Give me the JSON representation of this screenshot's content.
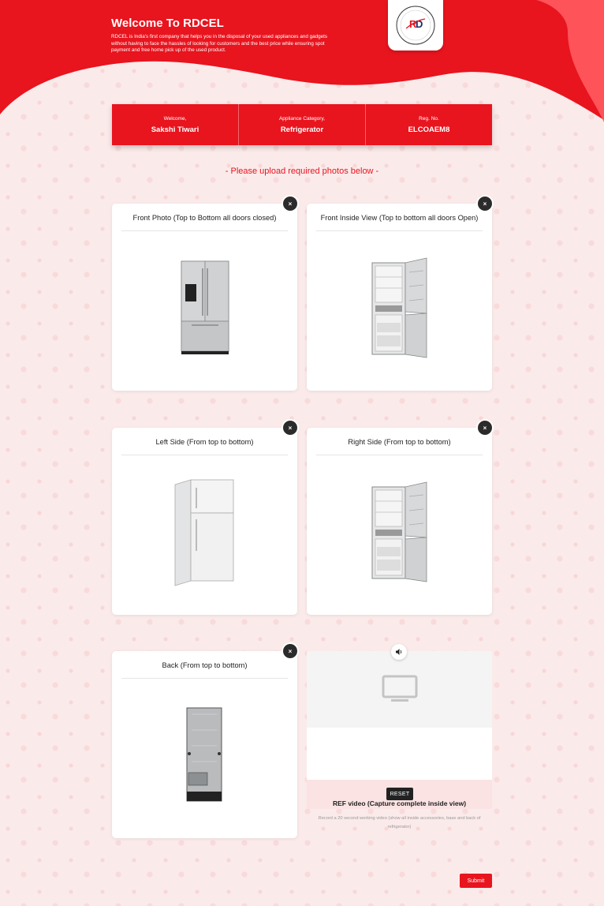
{
  "header": {
    "title": "Welcome To RDCEL",
    "description": "RDCEL is India's first company that helps you in the disposal of your used appliances and gadgets without having to face the hassles of looking for customers and the best price while ensuring spot payment and free home pick up of the used product.",
    "logo_text": "ROCKING DEALS",
    "logo_icon": "rd-logo-icon"
  },
  "info_bar": {
    "welcome_label": "Welcome,",
    "welcome_value": "Sakshi Tiwari",
    "category_label": "Appliance Category,",
    "category_value": "Refrigerator",
    "reg_label": "Reg. No.",
    "reg_value": "ELCOAEM8"
  },
  "upload_heading": "- Please upload required photos below -",
  "photos": [
    {
      "title": "Front Photo (Top to Bottom all doors closed)",
      "image": "fridge-front-closed"
    },
    {
      "title": "Front Inside View (Top to bottom all doors Open)",
      "image": "fridge-front-open"
    },
    {
      "title": "Left Side (From top to bottom)",
      "image": "fridge-left-side"
    },
    {
      "title": "Right Side (From top to bottom)",
      "image": "fridge-right-side"
    },
    {
      "title": "Back (From top to bottom)",
      "image": "fridge-back"
    }
  ],
  "close_glyph": "×",
  "video": {
    "title": "REF video (Capture complete inside view)",
    "description": "Record a 20 second working video (show all inside accessories, base and back of refrigerator)",
    "reset_label": "RESET",
    "sound_icon": "speaker-icon",
    "placeholder_icon": "monitor-icon"
  },
  "submit_label": "Submit",
  "colors": {
    "brand_red": "#e8141e",
    "page_bg": "#fbeaea"
  }
}
